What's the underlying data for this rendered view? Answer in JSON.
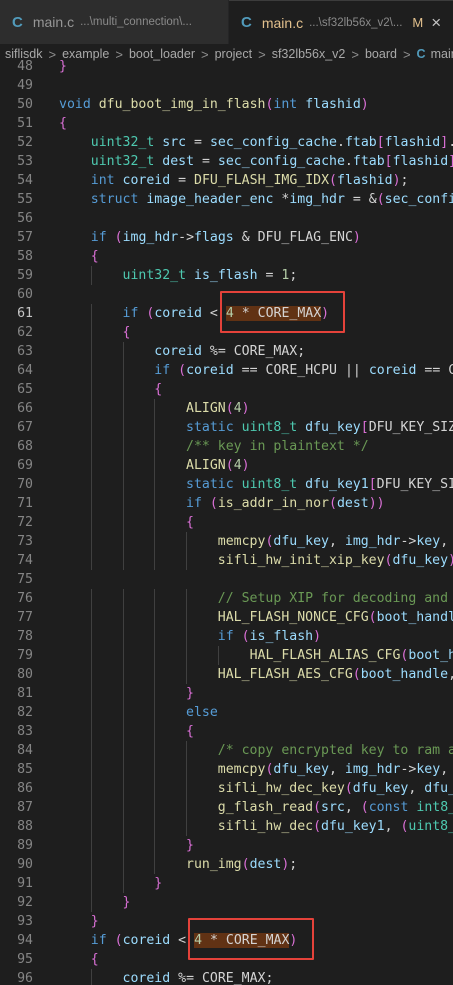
{
  "tabs": [
    {
      "icon": "C",
      "name": "main.c",
      "path": "...\\multi_connection\\...",
      "active": false
    },
    {
      "icon": "C",
      "name": "main.c",
      "path": "...\\sf32lb56x_v2\\...",
      "modified": "M",
      "close": "×",
      "active": true
    }
  ],
  "breadcrumb": [
    "siflisdk",
    "example",
    "boot_loader",
    "project",
    "sf32lb56x_v2",
    "board",
    "main"
  ],
  "breadcrumb_icon": "C",
  "breadcrumb_sep": ">",
  "lines": [
    {
      "n": "48",
      "t": "}"
    },
    {
      "n": "49",
      "t": ""
    },
    {
      "n": "50",
      "t": "void dfu_boot_img_in_flash(int flashid)"
    },
    {
      "n": "51",
      "t": "{"
    },
    {
      "n": "52",
      "t": "    uint32_t src = sec_config_cache.ftab[flashid].ba"
    },
    {
      "n": "53",
      "t": "    uint32_t dest = sec_config_cache.ftab[flashid].:"
    },
    {
      "n": "54",
      "t": "    int coreid = DFU_FLASH_IMG_IDX(flashid);"
    },
    {
      "n": "55",
      "t": "    struct image_header_enc *img_hdr = &(sec_config_"
    },
    {
      "n": "56",
      "t": ""
    },
    {
      "n": "57",
      "t": "    if (img_hdr->flags & DFU_FLAG_ENC)"
    },
    {
      "n": "58",
      "t": "    {"
    },
    {
      "n": "59",
      "t": "        uint32_t is_flash = 1;"
    },
    {
      "n": "60",
      "t": ""
    },
    {
      "n": "61",
      "t": "        if (coreid < 4 * CORE_MAX)"
    },
    {
      "n": "62",
      "t": "        {"
    },
    {
      "n": "63",
      "t": "            coreid %= CORE_MAX;"
    },
    {
      "n": "64",
      "t": "            if (coreid == CORE_HCPU || coreid == COR"
    },
    {
      "n": "65",
      "t": "            {"
    },
    {
      "n": "66",
      "t": "                ALIGN(4)"
    },
    {
      "n": "67",
      "t": "                static uint8_t dfu_key[DFU_KEY_SIZE]"
    },
    {
      "n": "68",
      "t": "                /** key in plaintext */"
    },
    {
      "n": "69",
      "t": "                ALIGN(4)"
    },
    {
      "n": "70",
      "t": "                static uint8_t dfu_key1[DFU_KEY_SIZE"
    },
    {
      "n": "71",
      "t": "                if (is_addr_in_nor(dest))"
    },
    {
      "n": "72",
      "t": "                {"
    },
    {
      "n": "73",
      "t": "                    memcpy(dfu_key, img_hdr->key, si"
    },
    {
      "n": "74",
      "t": "                    sifli_hw_init_xip_key(dfu_key);"
    },
    {
      "n": "75",
      "t": ""
    },
    {
      "n": "76",
      "t": "                    // Setup XIP for decoding and ru"
    },
    {
      "n": "77",
      "t": "                    HAL_FLASH_NONCE_CFG(boot_handle,"
    },
    {
      "n": "78",
      "t": "                    if (is_flash)"
    },
    {
      "n": "79",
      "t": "                        HAL_FLASH_ALIAS_CFG(boot_han"
    },
    {
      "n": "80",
      "t": "                    HAL_FLASH_AES_CFG(boot_handle, 1"
    },
    {
      "n": "81",
      "t": "                }"
    },
    {
      "n": "82",
      "t": "                else"
    },
    {
      "n": "83",
      "t": "                {"
    },
    {
      "n": "84",
      "t": "                    /* copy encrypted key to ram as"
    },
    {
      "n": "85",
      "t": "                    memcpy(dfu_key, img_hdr->key, si"
    },
    {
      "n": "86",
      "t": "                    sifli_hw_dec_key(dfu_key, dfu_ke"
    },
    {
      "n": "87",
      "t": "                    g_flash_read(src, (const int8_t"
    },
    {
      "n": "88",
      "t": "                    sifli_hw_dec(dfu_key1, (uint8_t"
    },
    {
      "n": "89",
      "t": "                }"
    },
    {
      "n": "90",
      "t": "                run_img(dest);"
    },
    {
      "n": "91",
      "t": "            }"
    },
    {
      "n": "92",
      "t": "        }"
    },
    {
      "n": "93",
      "t": "    }"
    },
    {
      "n": "94",
      "t": "    if (coreid < 4 * CORE_MAX)"
    },
    {
      "n": "95",
      "t": "    {"
    },
    {
      "n": "96",
      "t": "        coreid %= CORE_MAX;"
    }
  ],
  "current_line": "61",
  "highlight_boxes": [
    {
      "line": "61",
      "text": "4 * CORE_MAX",
      "color": "#e4423a"
    },
    {
      "line": "94",
      "text": "4 * CORE_MAX",
      "color": "#e4423a"
    }
  ],
  "colors": {
    "background": "#1e1e1e",
    "keyword": "#569cd6",
    "type": "#4ec9b0",
    "function": "#dcdcaa",
    "number": "#b5cea8",
    "comment": "#6a9955",
    "highlight": "#e4423a",
    "selection": "#613214"
  }
}
